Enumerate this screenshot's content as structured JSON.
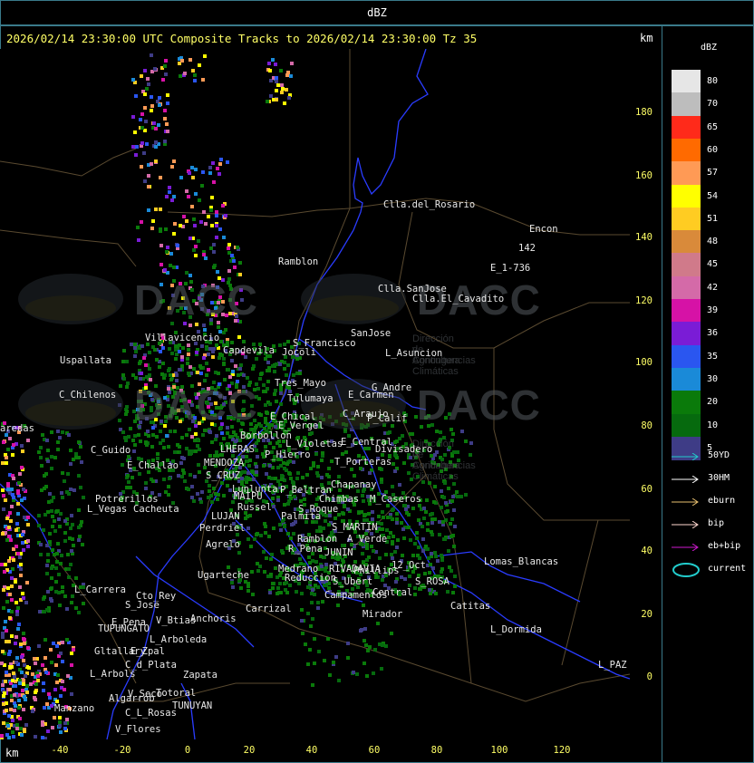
{
  "header": {
    "title": "dBZ"
  },
  "map": {
    "title": "2026/02/14 23:30:00 UTC Composite Tracks to 2026/02/14 23:30:00 Tz 35",
    "unit_top": "km",
    "unit_bottom": "km",
    "y_ticks": [
      "180",
      "160",
      "140",
      "120",
      "100",
      "80",
      "60",
      "40",
      "20",
      "0"
    ],
    "x_ticks": [
      "-40",
      "-20",
      "0",
      "20",
      "40",
      "60",
      "80",
      "100",
      "120"
    ],
    "watermark": {
      "text": "DACC",
      "line1": "Dirección de Agricultura",
      "line2": "y Contingencias Climáticas"
    },
    "places": [
      "Clla.del_Rosario",
      "Encon",
      "142",
      "E_1-736",
      "Ramblon",
      "Clla.SanJose",
      "Clla.El_Cavadito",
      "Uspallata",
      "S_Francisco",
      "SanJose",
      "L_Asuncion",
      "Villavicencio",
      "Capdevila",
      "Jocoli",
      "Tres_Mayo",
      "Tulumaya",
      "E_Carmen",
      "G_Andre",
      "C_Chilenos",
      "E_Chical",
      "E_Vergel",
      "C_Araujo",
      "P_Calif",
      "aredas",
      "Borbollon",
      "L_Violetas",
      "E_Central",
      "Divisadero",
      "C_Guido",
      "LHERAS",
      "P_Hierro",
      "E_Challao",
      "MENDOZA",
      "S_CRUZ",
      "Lunlunta",
      "T_Porteras",
      "Chapanay",
      "P_Beltran",
      "Chimbas",
      "M_Caseros",
      "Potrerillos",
      "L_Vegas",
      "Cacheuta",
      "MAIPU",
      "Russel",
      "S_Roque",
      "Palmita",
      "LUJAN",
      "Perdriel",
      "S_MARTIN",
      "A_Verde",
      "Agrelo",
      "R_Pena",
      "JUNIN",
      "Ramblon",
      "Ugarteche",
      "Medrano",
      "RIVADAVIA",
      "Phillips",
      "12_Oct",
      "Lomas_Blancas",
      "Reduccion",
      "S_Ubert",
      "S_ROSA",
      "L_Carrera",
      "Cto_Rey",
      "Campamentos",
      "Central",
      "S_Jose",
      "Carrizal",
      "Catitas",
      "E_Pena",
      "V_Btias",
      "Anchoris",
      "Mirador",
      "TUPUNGATO",
      "L_Arboleda",
      "L_Dormida",
      "Gltallary",
      "E_Zpal",
      "L_Arbols",
      "C_d_Plata",
      "Zapata",
      "L_PAZ",
      "Algarrob",
      "V_Seco",
      "Totoral",
      "TUNUYAN",
      "Manzano",
      "C_L_Rosas",
      "V_Flores"
    ]
  },
  "legend": {
    "title": "dBZ",
    "bins": [
      {
        "label": "80",
        "color": "#e6e6e6"
      },
      {
        "label": "70",
        "color": "#bdbdbd"
      },
      {
        "label": "65",
        "color": "#ff2a1a"
      },
      {
        "label": "60",
        "color": "#ff6a00"
      },
      {
        "label": "57",
        "color": "#ff9a55"
      },
      {
        "label": "54",
        "color": "#ffff00"
      },
      {
        "label": "51",
        "color": "#ffcc22"
      },
      {
        "label": "48",
        "color": "#d98a3a"
      },
      {
        "label": "45",
        "color": "#d07a8a"
      },
      {
        "label": "42",
        "color": "#d46aa8"
      },
      {
        "label": "39",
        "color": "#d612a6"
      },
      {
        "label": "36",
        "color": "#7a1cd6"
      },
      {
        "label": "35",
        "color": "#2a56f0"
      },
      {
        "label": "30",
        "color": "#1a8ad8"
      },
      {
        "label": "20",
        "color": "#0a7a0a"
      },
      {
        "label": "10",
        "color": "#066a0e"
      },
      {
        "label": "5",
        "color": "#3e3c86"
      }
    ],
    "tracks": [
      {
        "label": "50YD",
        "color": "#22cccc"
      },
      {
        "label": "30HM",
        "color": "#ffffff"
      },
      {
        "label": "eburn",
        "color": "#e8c070"
      },
      {
        "label": "bip",
        "color": "#ffd8d0"
      },
      {
        "label": "eb+bip",
        "color": "#d01ad0"
      },
      {
        "label": "current",
        "color": "#22cccc"
      }
    ]
  }
}
